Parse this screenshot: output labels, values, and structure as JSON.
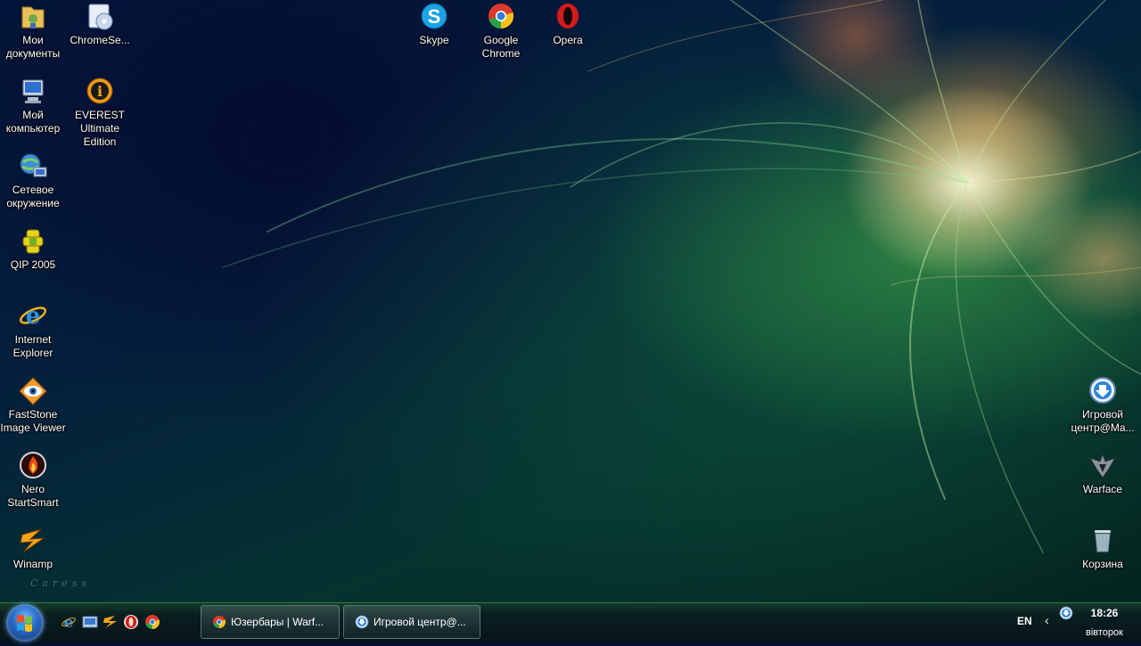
{
  "desktop": {
    "watermark": "Caress",
    "icons": [
      {
        "id": "my-documents",
        "label": "Мои документы"
      },
      {
        "id": "chrome-setup",
        "label": "ChromeSe..."
      },
      {
        "id": "my-computer",
        "label": "Мой компьютер"
      },
      {
        "id": "everest",
        "label": "EVEREST Ultimate Edition"
      },
      {
        "id": "network",
        "label": "Сетевое окружение"
      },
      {
        "id": "qip",
        "label": "QIP 2005"
      },
      {
        "id": "internet-explorer",
        "label": "Internet Explorer"
      },
      {
        "id": "faststone",
        "label": "FastStone Image Viewer"
      },
      {
        "id": "nero",
        "label": "Nero StartSmart"
      },
      {
        "id": "winamp",
        "label": "Winamp"
      },
      {
        "id": "skype",
        "label": "Skype"
      },
      {
        "id": "google-chrome",
        "label": "Google Chrome"
      },
      {
        "id": "opera",
        "label": "Opera"
      },
      {
        "id": "game-center",
        "label": "Игровой центр@Ma..."
      },
      {
        "id": "warface",
        "label": "Warface"
      },
      {
        "id": "recycle-bin",
        "label": "Корзина"
      }
    ]
  },
  "taskbar": {
    "quick_launch": [
      "internet-explorer-icon",
      "show-desktop-icon",
      "winamp-icon",
      "opera-icon",
      "chrome-icon"
    ],
    "tasks": [
      {
        "label": "Юзербары | Warf..."
      },
      {
        "label": "Игровой центр@..."
      }
    ],
    "language": "EN",
    "clock": {
      "time": "18:26",
      "day": "вівторок"
    }
  },
  "colors": {
    "taskbar_border": "#2f7a45",
    "wallpaper_glow": "#fff6d0",
    "wallpaper_green": "#379646"
  }
}
